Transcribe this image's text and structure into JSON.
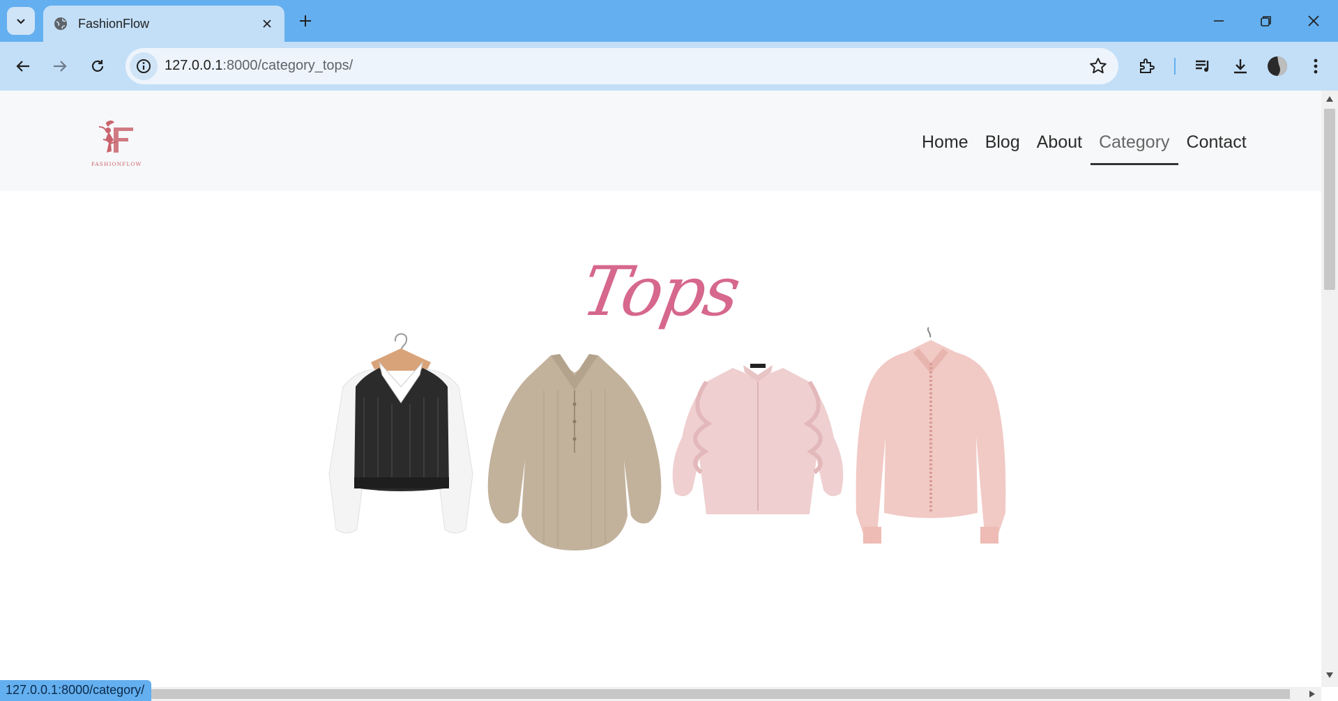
{
  "browser": {
    "tab_title": "FashionFlow",
    "url_host": "127.0.0.1",
    "url_rest": ":8000/category_tops/",
    "status_url": "127.0.0.1:8000/category/"
  },
  "site": {
    "logo_text": "FASHIONFLOW",
    "nav": [
      {
        "label": "Home"
      },
      {
        "label": "Blog"
      },
      {
        "label": "About"
      },
      {
        "label": "Category"
      },
      {
        "label": "Contact"
      }
    ],
    "active_nav": "Category",
    "heading": "Tops"
  },
  "colors": {
    "chrome": "#64afef",
    "toolbar": "#c3dff8",
    "heading": "#d6678d",
    "logo": "#c9646e"
  },
  "products": [
    {
      "name": "knit-vest-shirt",
      "icon": "black-vest-white-sleeves"
    },
    {
      "name": "beige-striped-blouse",
      "icon": "beige-blouse"
    },
    {
      "name": "pink-ruffle-blouse",
      "icon": "pink-ruffle-blouse"
    },
    {
      "name": "pink-sheer-blouse",
      "icon": "pink-sheer-blouse"
    }
  ]
}
